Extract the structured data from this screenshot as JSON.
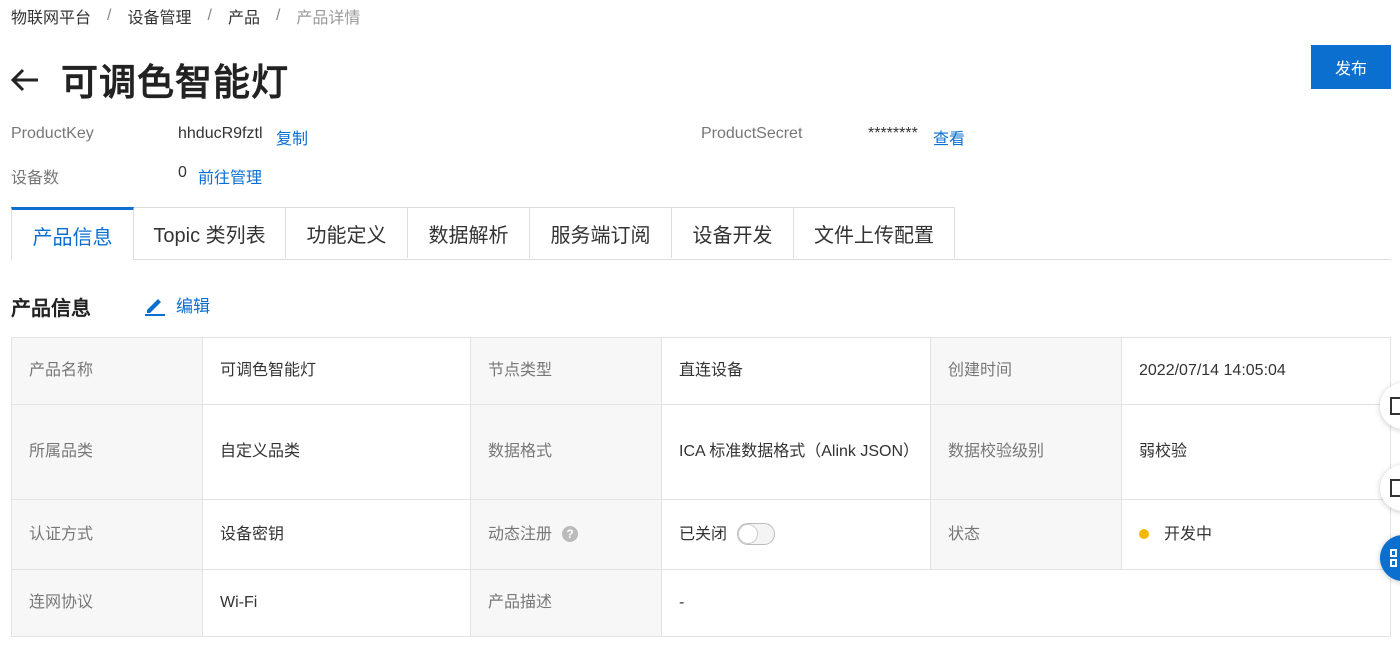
{
  "breadcrumb": [
    "物联网平台",
    "设备管理",
    "产品",
    "产品详情"
  ],
  "breadcrumb_sep": "/",
  "title": "可调色智能灯",
  "publish_label": "发布",
  "meta": {
    "product_key_label": "ProductKey",
    "product_key_value": "hhducR9fztl",
    "copy_label": "复制",
    "product_secret_label": "ProductSecret",
    "product_secret_value": "********",
    "view_label": "查看",
    "device_count_label": "设备数",
    "device_count_value": "0",
    "manage_label": "前往管理"
  },
  "tabs": [
    "产品信息",
    "Topic 类列表",
    "功能定义",
    "数据解析",
    "服务端订阅",
    "设备开发",
    "文件上传配置"
  ],
  "active_tab": 0,
  "section": {
    "title": "产品信息",
    "edit_label": "编辑"
  },
  "info": {
    "product_name_label": "产品名称",
    "product_name": "可调色智能灯",
    "node_type_label": "节点类型",
    "node_type": "直连设备",
    "created_label": "创建时间",
    "created": "2022/07/14 14:05:04",
    "category_label": "所属品类",
    "category": "自定义品类",
    "data_format_label": "数据格式",
    "data_format": "ICA 标准数据格式（Alink JSON）",
    "verify_level_label": "数据校验级别",
    "verify_level": "弱校验",
    "auth_label": "认证方式",
    "auth": "设备密钥",
    "dynamic_reg_label": "动态注册",
    "dynamic_reg": "已关闭",
    "dynamic_reg_on": false,
    "status_label": "状态",
    "status": "开发中",
    "status_color": "#f5b800",
    "network_label": "连网协议",
    "network": "Wi-Fi",
    "desc_label": "产品描述",
    "desc": "-"
  },
  "accent_color": "#0b6fd0",
  "icons": {
    "back": "arrow-left-icon",
    "edit": "pencil-icon",
    "help": "question-circle-icon"
  }
}
